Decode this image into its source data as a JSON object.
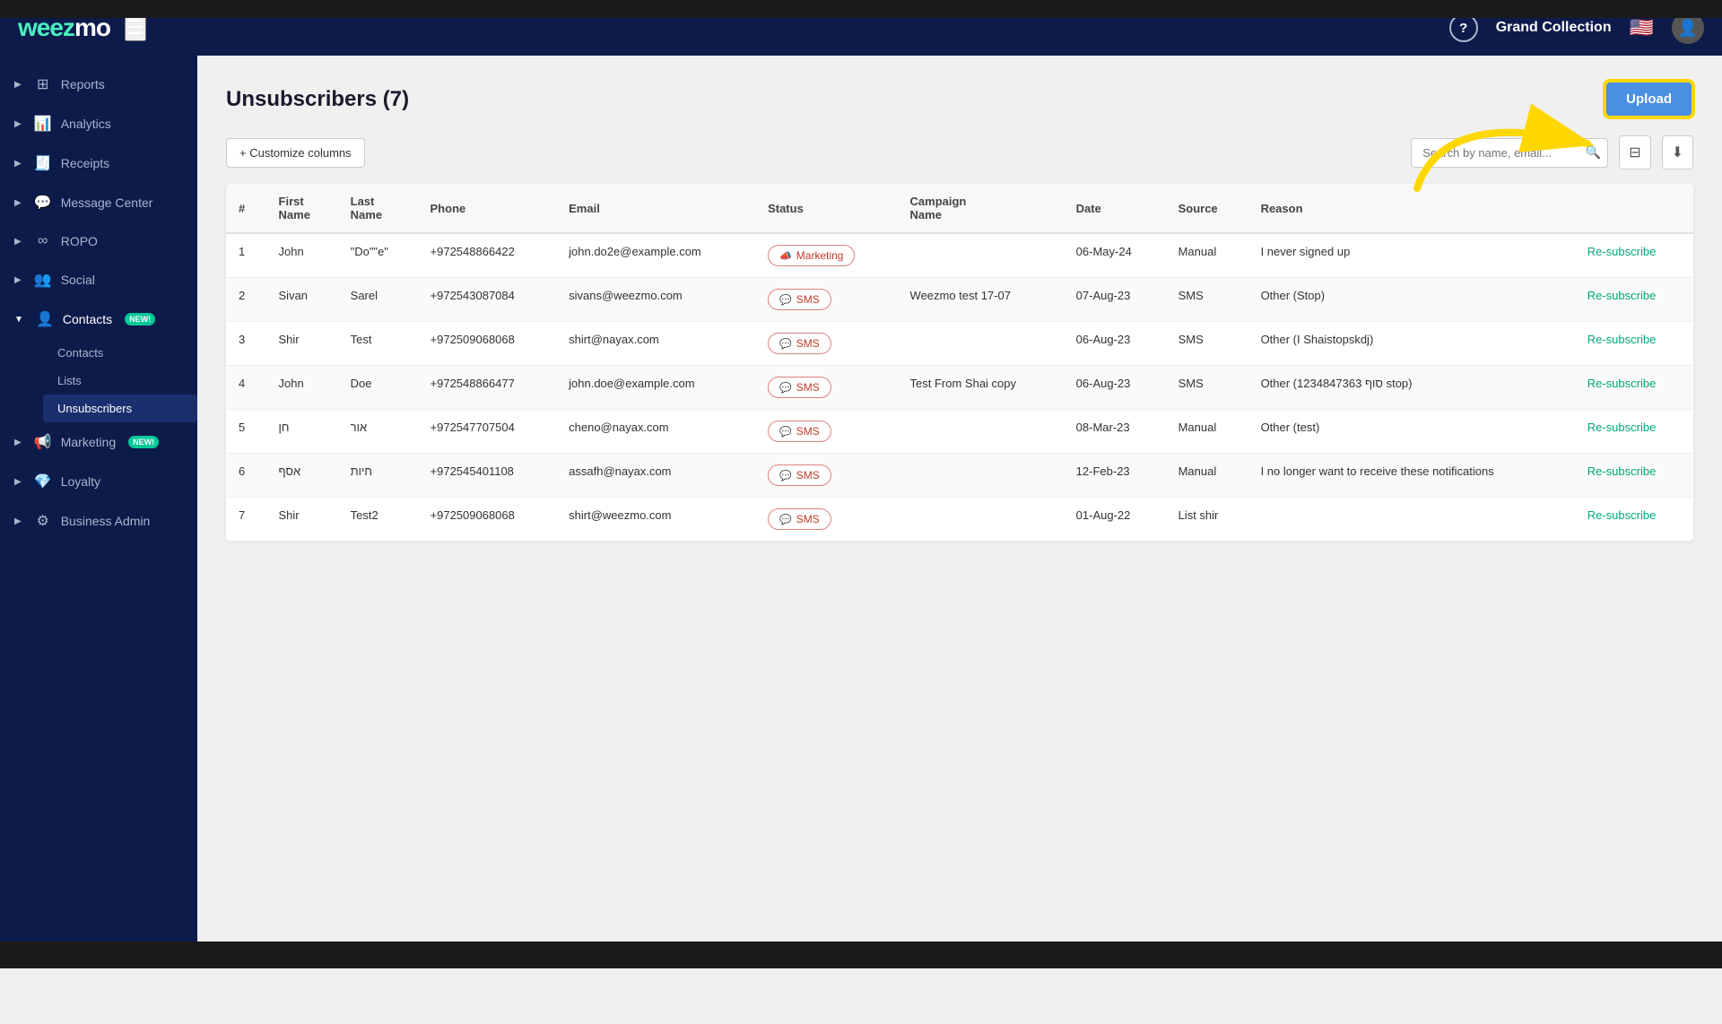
{
  "topbar": {
    "logo": "weezmo",
    "org_name": "Grand Collection",
    "flag": "🇺🇸"
  },
  "sidebar": {
    "items": [
      {
        "id": "reports",
        "label": "Reports",
        "icon": "⊞",
        "arrow": "▶"
      },
      {
        "id": "analytics",
        "label": "Analytics",
        "icon": "📊",
        "arrow": "▶"
      },
      {
        "id": "receipts",
        "label": "Receipts",
        "icon": "🧾",
        "arrow": "▶"
      },
      {
        "id": "message-center",
        "label": "Message Center",
        "icon": "💬",
        "arrow": "▶"
      },
      {
        "id": "ropo",
        "label": "ROPO",
        "icon": "∞",
        "arrow": "▶"
      },
      {
        "id": "social",
        "label": "Social",
        "icon": "👥",
        "arrow": "▶"
      },
      {
        "id": "contacts",
        "label": "Contacts",
        "icon": "👤",
        "arrow": "▼",
        "badge": "NEW!"
      },
      {
        "id": "marketing",
        "label": "Marketing",
        "icon": "📢",
        "arrow": "▶",
        "badge": "NEW!"
      },
      {
        "id": "loyalty",
        "label": "Loyalty",
        "icon": "💎",
        "arrow": "▶"
      },
      {
        "id": "business-admin",
        "label": "Business Admin",
        "icon": "⚙",
        "arrow": "▶"
      }
    ],
    "contacts_sub": [
      {
        "id": "contacts-sub",
        "label": "Contacts"
      },
      {
        "id": "lists",
        "label": "Lists"
      },
      {
        "id": "unsubscribers",
        "label": "Unsubscribers",
        "active": true
      }
    ]
  },
  "page": {
    "title": "Unsubscribers (7)",
    "customize_btn": "+ Customize columns",
    "search_placeholder": "Search by name, email...",
    "upload_btn": "Upload"
  },
  "table": {
    "columns": [
      "#",
      "First Name",
      "Last Name",
      "Phone",
      "Email",
      "Status",
      "Campaign Name",
      "Date",
      "Source",
      "Reason",
      ""
    ],
    "rows": [
      {
        "num": "1",
        "first": "John",
        "last": "\"Do\"\"e\"",
        "phone": "+972548866422",
        "email": "john.do2e@example.com",
        "status": "Marketing",
        "status_type": "marketing",
        "campaign": "",
        "date": "06-May-24",
        "source": "Manual",
        "reason": "I never signed up",
        "action": "Re-subscribe"
      },
      {
        "num": "2",
        "first": "Sivan",
        "last": "Sarel",
        "phone": "+972543087084",
        "email": "sivans@weezmo.com",
        "status": "SMS",
        "status_type": "sms",
        "campaign": "Weezmo test 17-07",
        "date": "07-Aug-23",
        "source": "SMS",
        "reason": "Other (Stop)",
        "action": "Re-subscribe"
      },
      {
        "num": "3",
        "first": "Shir",
        "last": "Test",
        "phone": "+972509068068",
        "email": "shirt@nayax.com",
        "status": "SMS",
        "status_type": "sms",
        "campaign": "",
        "date": "06-Aug-23",
        "source": "SMS",
        "reason": "Other (I Shaistopskdj)",
        "action": "Re-subscribe"
      },
      {
        "num": "4",
        "first": "John",
        "last": "Doe",
        "phone": "+972548866477",
        "email": "john.doe@example.com",
        "status": "SMS",
        "status_type": "sms",
        "campaign": "Test From Shai copy",
        "date": "06-Aug-23",
        "source": "SMS",
        "reason": "Other (סוף 1234847363 stop)",
        "action": "Re-subscribe"
      },
      {
        "num": "5",
        "first": "חן",
        "last": "אור",
        "phone": "+972547707504",
        "email": "cheno@nayax.com",
        "status": "SMS",
        "status_type": "sms",
        "campaign": "",
        "date": "08-Mar-23",
        "source": "Manual",
        "reason": "Other (test)",
        "action": "Re-subscribe"
      },
      {
        "num": "6",
        "first": "אסף",
        "last": "חיות",
        "phone": "+972545401108",
        "email": "assafh@nayax.com",
        "status": "SMS",
        "status_type": "sms",
        "campaign": "",
        "date": "12-Feb-23",
        "source": "Manual",
        "reason": "I no longer want to receive these notifications",
        "action": "Re-subscribe"
      },
      {
        "num": "7",
        "first": "Shir",
        "last": "Test2",
        "phone": "+972509068068",
        "email": "shirt@weezmo.com",
        "status": "SMS",
        "status_type": "sms",
        "campaign": "",
        "date": "01-Aug-22",
        "source": "List shir",
        "reason": "",
        "action": "Re-subscribe"
      }
    ]
  },
  "icons": {
    "hamburger": "☰",
    "help": "?",
    "search": "🔍",
    "filter": "⊟",
    "download": "⬇",
    "sms": "💬",
    "marketing": "📣"
  }
}
